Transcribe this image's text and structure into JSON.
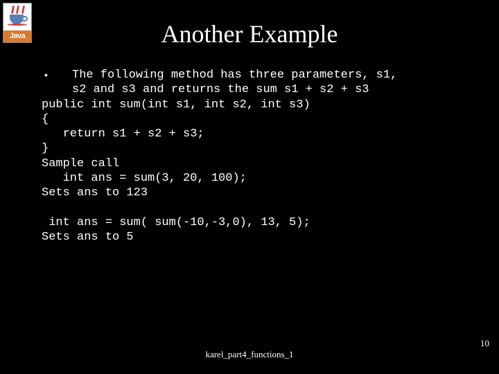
{
  "logo": {
    "label": "Java"
  },
  "title": "Another Example",
  "bullet_text_line1": "The following method has three parameters, s1,",
  "bullet_text_line2": "s2 and s3 and returns the sum s1 + s2 + s3",
  "code_block1": "public int sum(int s1, int s2, int s3)\n{\n   return s1 + s2 + s3;\n}\nSample call\n   int ans = sum(3, 20, 100);\nSets ans to 123",
  "code_block2": " int ans = sum( sum(-10,-3,0), 13, 5);\nSets ans to 5",
  "footer": "karel_part4_functions_1",
  "page_number": "10"
}
